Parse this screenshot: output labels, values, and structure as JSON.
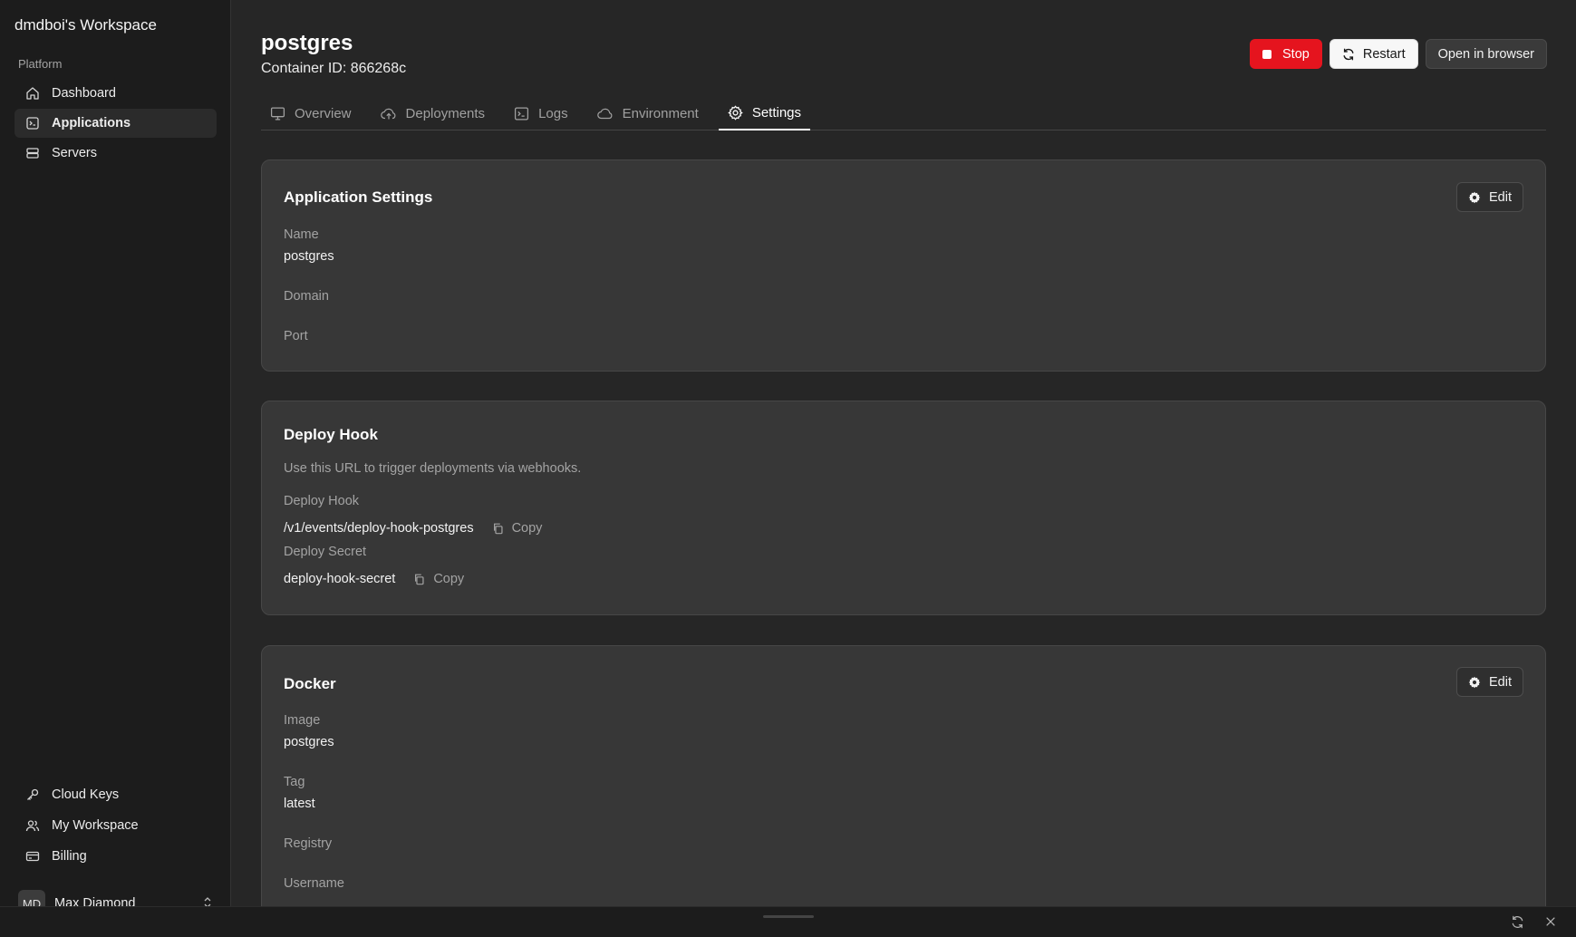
{
  "sidebar": {
    "workspace_title": "dmdboi's Workspace",
    "section_label": "Platform",
    "nav": [
      {
        "label": "Dashboard",
        "icon": "home-icon"
      },
      {
        "label": "Applications",
        "icon": "app-window-icon",
        "active": true
      },
      {
        "label": "Servers",
        "icon": "server-icon"
      }
    ],
    "bottom_nav": [
      {
        "label": "Cloud Keys",
        "icon": "key-icon"
      },
      {
        "label": "My Workspace",
        "icon": "users-icon"
      },
      {
        "label": "Billing",
        "icon": "credit-card-icon"
      }
    ],
    "user": {
      "initials": "MD",
      "name": "Max Diamond"
    }
  },
  "header": {
    "title": "postgres",
    "container_id": "Container ID: 866268c",
    "actions": {
      "stop": "Stop",
      "restart": "Restart",
      "open": "Open in browser"
    },
    "colors": {
      "stop": "#e5141e"
    }
  },
  "tabs": [
    {
      "label": "Overview",
      "icon": "monitor-icon"
    },
    {
      "label": "Deployments",
      "icon": "cloud-upload-icon"
    },
    {
      "label": "Logs",
      "icon": "terminal-icon"
    },
    {
      "label": "Environment",
      "icon": "cloud-icon"
    },
    {
      "label": "Settings",
      "icon": "gear-icon",
      "active": true
    }
  ],
  "app_settings": {
    "title": "Application Settings",
    "edit_label": "Edit",
    "fields": [
      {
        "label": "Name",
        "value": "postgres"
      },
      {
        "label": "Domain",
        "value": ""
      },
      {
        "label": "Port",
        "value": ""
      }
    ]
  },
  "deploy_hook": {
    "title": "Deploy Hook",
    "description": "Use this URL to trigger deployments via webhooks.",
    "hook_label": "Deploy Hook",
    "hook_value": "/v1/events/deploy-hook-postgres",
    "secret_label": "Deploy Secret",
    "secret_value": "deploy-hook-secret",
    "copy_label": "Copy"
  },
  "docker": {
    "title": "Docker",
    "edit_label": "Edit",
    "fields": [
      {
        "label": "Image",
        "value": "postgres"
      },
      {
        "label": "Tag",
        "value": "latest"
      },
      {
        "label": "Registry",
        "value": ""
      },
      {
        "label": "Username",
        "value": ""
      }
    ]
  }
}
